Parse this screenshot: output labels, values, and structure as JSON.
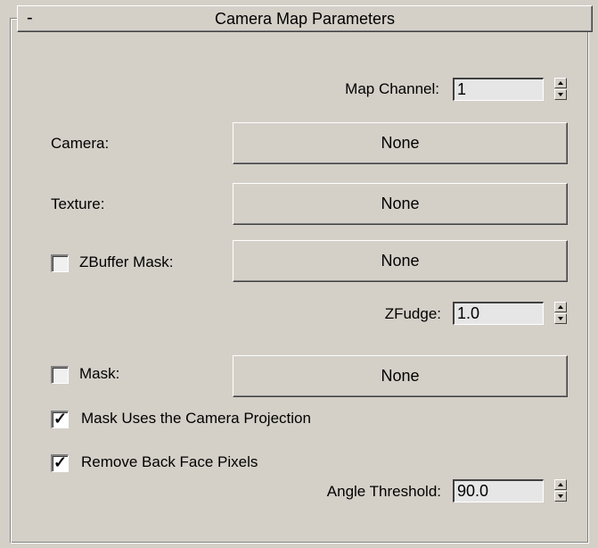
{
  "rollout": {
    "title": "Camera Map Parameters",
    "collapse_symbol": "-"
  },
  "map_channel": {
    "label": "Map Channel:",
    "value": "1"
  },
  "camera": {
    "label": "Camera:",
    "button": "None"
  },
  "texture": {
    "label": "Texture:",
    "button": "None"
  },
  "zbuffer_mask": {
    "label": "ZBuffer Mask:",
    "button": "None",
    "checked": false
  },
  "zfudge": {
    "label": "ZFudge:",
    "value": "1.0"
  },
  "mask": {
    "label": "Mask:",
    "button": "None",
    "checked": false
  },
  "mask_uses_projection": {
    "label": "Mask Uses the Camera Projection",
    "checked": true,
    "checkmark": "✓"
  },
  "remove_back_face": {
    "label": "Remove Back Face Pixels",
    "checked": true,
    "checkmark": "✓"
  },
  "angle_threshold": {
    "label": "Angle Threshold:",
    "value": "90.0"
  },
  "icons": {
    "spinner": "up-down-spinner-icon",
    "check": "checkmark-icon"
  }
}
